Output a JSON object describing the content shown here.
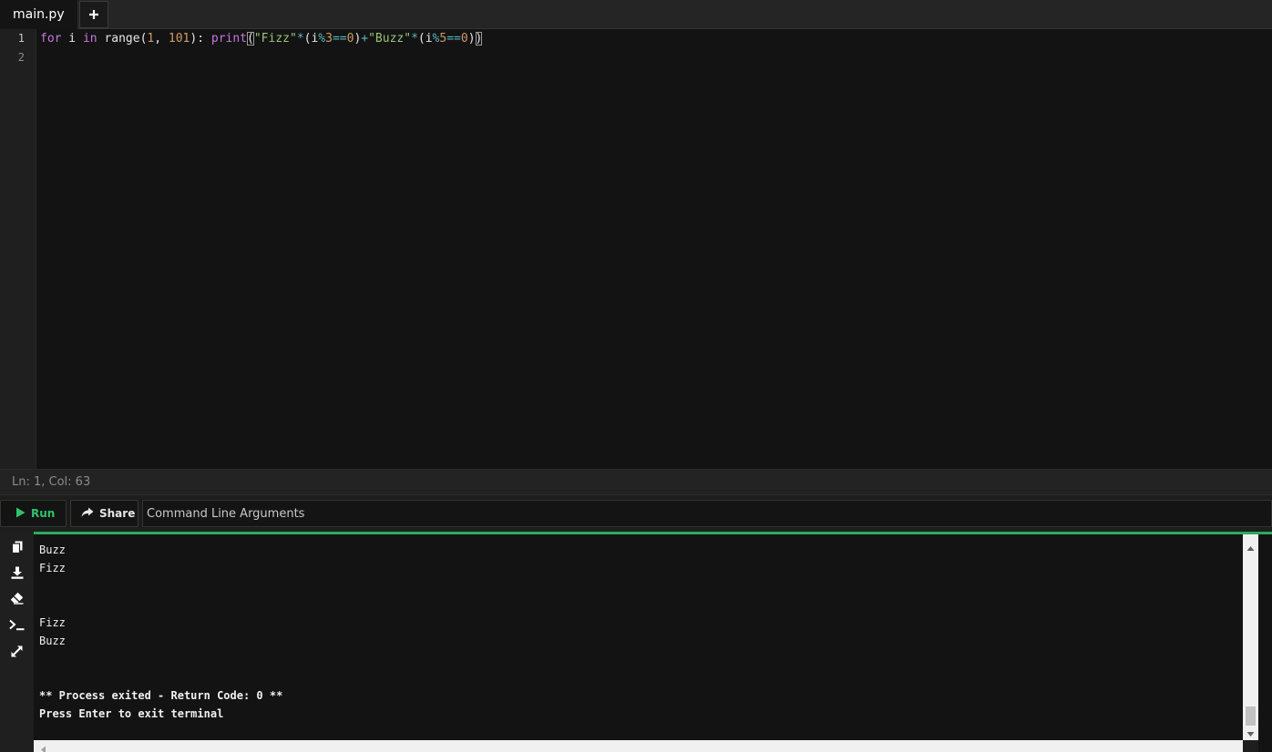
{
  "tabs": {
    "active_file": "main.py",
    "add_icon": "plus-icon"
  },
  "editor": {
    "line_numbers": [
      "1",
      "2"
    ],
    "code_tokens": [
      {
        "text": "for",
        "color": "#c678dd"
      },
      {
        "text": " i ",
        "color": "#e6e6e6"
      },
      {
        "text": "in",
        "color": "#c678dd"
      },
      {
        "text": " range(",
        "color": "#e6e6e6"
      },
      {
        "text": "1",
        "color": "#d19a66"
      },
      {
        "text": ", ",
        "color": "#e6e6e6"
      },
      {
        "text": "101",
        "color": "#d19a66"
      },
      {
        "text": "): ",
        "color": "#e6e6e6"
      },
      {
        "text": "print",
        "color": "#c678dd"
      },
      {
        "text": "(",
        "color": "#e6e6e6",
        "cursor": true
      },
      {
        "text": "\"Fizz\"",
        "color": "#98c379"
      },
      {
        "text": "*",
        "color": "#56b6c2"
      },
      {
        "text": "(i",
        "color": "#e6e6e6"
      },
      {
        "text": "%",
        "color": "#56b6c2"
      },
      {
        "text": "3",
        "color": "#d19a66"
      },
      {
        "text": "==",
        "color": "#56b6c2"
      },
      {
        "text": "0",
        "color": "#d19a66"
      },
      {
        "text": ")",
        "color": "#e6e6e6"
      },
      {
        "text": "+",
        "color": "#56b6c2"
      },
      {
        "text": "\"Buzz\"",
        "color": "#98c379"
      },
      {
        "text": "*",
        "color": "#56b6c2"
      },
      {
        "text": "(i",
        "color": "#e6e6e6"
      },
      {
        "text": "%",
        "color": "#56b6c2"
      },
      {
        "text": "5",
        "color": "#d19a66"
      },
      {
        "text": "==",
        "color": "#56b6c2"
      },
      {
        "text": "0",
        "color": "#d19a66"
      },
      {
        "text": ")",
        "color": "#e6e6e6"
      },
      {
        "text": ")",
        "color": "#e6e6e6",
        "cursor": true
      }
    ]
  },
  "status": {
    "position": "Ln: 1,  Col: 63"
  },
  "controls": {
    "run_label": "Run",
    "share_label": "Share",
    "args_placeholder": "Command Line Arguments",
    "run_color": "#2ec46a"
  },
  "terminal": {
    "lines": [
      {
        "text": "Buzz",
        "bold": false
      },
      {
        "text": "Fizz",
        "bold": false
      },
      {
        "text": "",
        "bold": false
      },
      {
        "text": "",
        "bold": false
      },
      {
        "text": "Fizz",
        "bold": false
      },
      {
        "text": "Buzz",
        "bold": false
      },
      {
        "text": "",
        "bold": false
      },
      {
        "text": "",
        "bold": false
      },
      {
        "text": "** Process exited - Return Code: 0 **",
        "bold": true
      },
      {
        "text": "Press Enter to exit terminal",
        "bold": true
      }
    ],
    "side_icons": [
      "copy-icon",
      "download-icon",
      "eraser-icon",
      "terminal-icon",
      "expand-icon"
    ],
    "accent_color": "#2ca95a"
  }
}
